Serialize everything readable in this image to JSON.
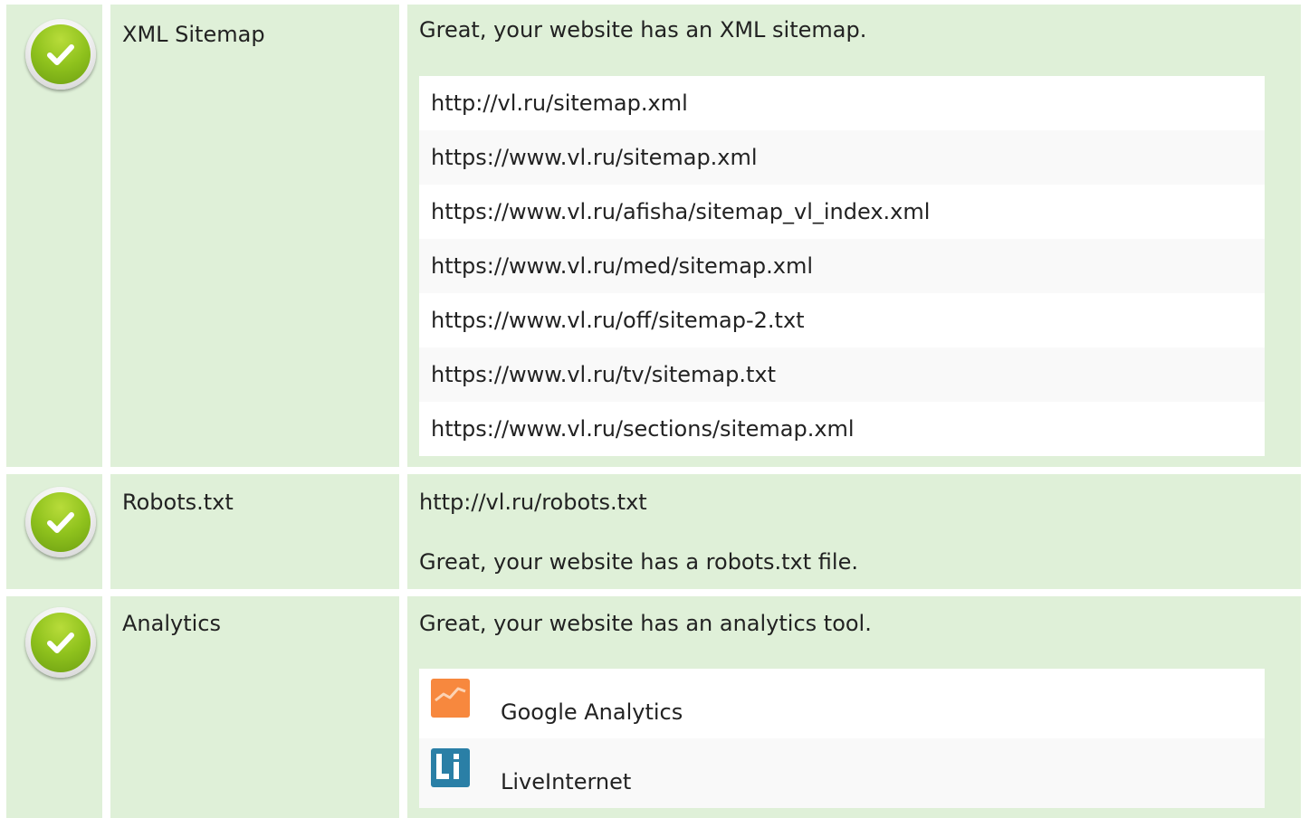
{
  "rows": [
    {
      "label": "XML Sitemap",
      "message": "Great, your website has an XML sitemap.",
      "status_icon": "check-circle-icon",
      "sitemaps": [
        "http://vl.ru/sitemap.xml",
        "https://www.vl.ru/sitemap.xml",
        "https://www.vl.ru/afisha/sitemap_vl_index.xml",
        "https://www.vl.ru/med/sitemap.xml",
        "https://www.vl.ru/off/sitemap-2.txt",
        "https://www.vl.ru/tv/sitemap.txt",
        "https://www.vl.ru/sections/sitemap.xml"
      ]
    },
    {
      "label": "Robots.txt",
      "url": "http://vl.ru/robots.txt",
      "message": "Great, your website has a robots.txt file.",
      "status_icon": "check-circle-icon"
    },
    {
      "label": "Analytics",
      "message": "Great, your website has an analytics tool.",
      "status_icon": "check-circle-icon",
      "tools": [
        {
          "name": "Google Analytics",
          "icon": "google-analytics-icon"
        },
        {
          "name": "LiveInternet",
          "icon": "liveinternet-icon"
        }
      ]
    }
  ],
  "colors": {
    "row_background": "#dff0d8",
    "check_green": "#8fc21d",
    "google_analytics_orange": "#f7883e",
    "liveinternet_teal": "#2a7fa6"
  }
}
